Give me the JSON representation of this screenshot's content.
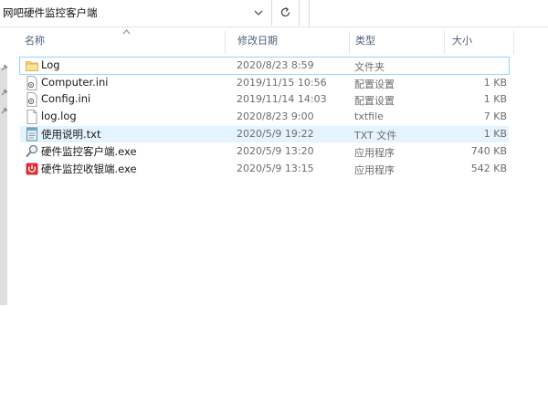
{
  "address_bar": {
    "path": "网吧硬件监控客户端"
  },
  "columns": {
    "name": "名称",
    "date": "修改日期",
    "type": "类型",
    "size": "大小"
  },
  "files": [
    {
      "name": "Log",
      "date": "2020/8/23 8:59",
      "type": "文件夹",
      "size": "",
      "icon": "folder-icon"
    },
    {
      "name": "Computer.ini",
      "date": "2019/11/15 10:56",
      "type": "配置设置",
      "size": "1 KB",
      "icon": "config-file-icon"
    },
    {
      "name": "Config.ini",
      "date": "2019/11/14 14:03",
      "type": "配置设置",
      "size": "1 KB",
      "icon": "config-file-icon"
    },
    {
      "name": "log.log",
      "date": "2020/8/23 9:00",
      "type": "txtfile",
      "size": "7 KB",
      "icon": "blank-file-icon"
    },
    {
      "name": "使用说明.txt",
      "date": "2020/5/9 19:22",
      "type": "TXT 文件",
      "size": "1 KB",
      "icon": "text-file-icon"
    },
    {
      "name": "硬件监控客户端.exe",
      "date": "2020/5/9 13:20",
      "type": "应用程序",
      "size": "740 KB",
      "icon": "magnifier-app-icon"
    },
    {
      "name": "硬件监控收银端.exe",
      "date": "2020/5/9 13:15",
      "type": "应用程序",
      "size": "542 KB",
      "icon": "red-power-app-icon"
    }
  ],
  "colors": {
    "selection_border": "#99d1ff",
    "hover_bg": "#e5f3ff",
    "header_text": "#4c607a",
    "folder": "#f8d775"
  }
}
